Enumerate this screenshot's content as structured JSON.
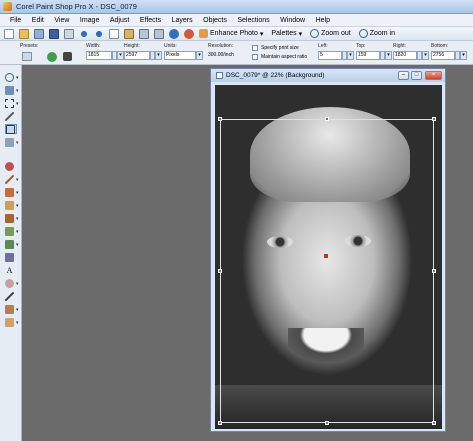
{
  "app": {
    "title": "Corel Paint Shop Pro X - DSC_0079"
  },
  "menu": [
    "File",
    "Edit",
    "View",
    "Image",
    "Adjust",
    "Effects",
    "Layers",
    "Objects",
    "Selections",
    "Window",
    "Help"
  ],
  "toolbar": {
    "enhance_photo": "Enhance Photo",
    "palettes": "Palettes",
    "zoom_out": "Zoom out",
    "zoom_in": "Zoom in"
  },
  "options": {
    "presets_label": "Presets:",
    "width_label": "Width:",
    "width_value": "1815",
    "height_label": "Height:",
    "height_value": "2597",
    "units_label": "Units:",
    "units_value": "Pixels",
    "resolution_label": "Resolution:",
    "resolution_value": "300.00/inch",
    "specify_print_size": "Specify print size",
    "maintain_aspect_ratio": "Maintain aspect ratio",
    "left_label": "Left:",
    "left_value": "5",
    "top_label": "Top:",
    "top_value": "159",
    "right_label": "Right:",
    "right_value": "1820",
    "bottom_label": "Bottom:",
    "bottom_value": "2756"
  },
  "document": {
    "title": "DSC_0079* @ 22% (Background)"
  },
  "colors": {
    "workspace": "#6b6b6b",
    "crop_center": "#c0302a"
  }
}
